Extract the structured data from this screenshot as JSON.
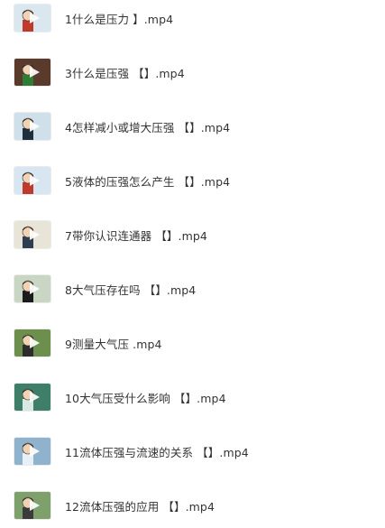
{
  "files": [
    {
      "name": "1什么是压力 】.mp4",
      "thumb_bg": "#dbe7ee",
      "thumb_accent": "#c0392b",
      "icon": "play-icon"
    },
    {
      "name": "3什么是压强 【】.mp4",
      "thumb_bg": "#5a3a2a",
      "thumb_accent": "#2e7d32",
      "icon": "play-icon"
    },
    {
      "name": "4怎样减小或增大压强 【】.mp4",
      "thumb_bg": "#cfe0ea",
      "thumb_accent": "#1f2d3d",
      "icon": "play-icon"
    },
    {
      "name": "5液体的压强怎么产生 【】.mp4",
      "thumb_bg": "#d7e6f0",
      "thumb_accent": "#c0392b",
      "icon": "play-icon"
    },
    {
      "name": "7带你认识连通器 【】.mp4",
      "thumb_bg": "#e8e4d8",
      "thumb_accent": "#2c3e50",
      "icon": "play-icon"
    },
    {
      "name": "8大气压存在吗 【】.mp4",
      "thumb_bg": "#c9d6c4",
      "thumb_accent": "#1b1b1b",
      "icon": "play-icon"
    },
    {
      "name": "9测量大气压 .mp4",
      "thumb_bg": "#6c8f4e",
      "thumb_accent": "#2d2d2d",
      "icon": "play-icon"
    },
    {
      "name": "10大气压受什么影响 【】.mp4",
      "thumb_bg": "#3f7f6a",
      "thumb_accent": "#d9e8e0",
      "icon": "play-icon"
    },
    {
      "name": "11流体压强与流速的关系 【】.mp4",
      "thumb_bg": "#8fb3cc",
      "thumb_accent": "#e6f0f6",
      "icon": "play-icon"
    },
    {
      "name": "12流体压强的应用 【】.mp4",
      "thumb_bg": "#7ea06a",
      "thumb_accent": "#3b3b3b",
      "icon": "play-icon"
    }
  ]
}
